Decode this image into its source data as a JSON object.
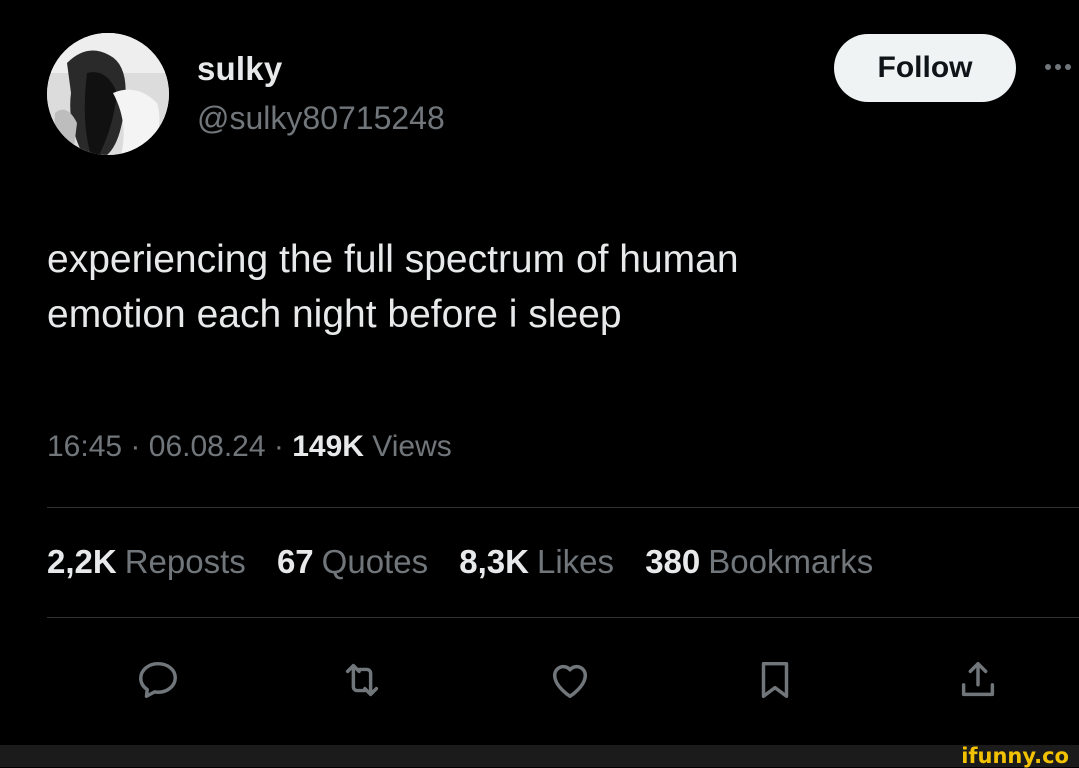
{
  "author": {
    "name": "sulky",
    "handle": "@sulky80715248"
  },
  "follow_button": {
    "label": "Follow"
  },
  "tweet": {
    "text_line_1": "experiencing the full spectrum of human",
    "text_line_2": "emotion each night before i sleep"
  },
  "meta": {
    "time": "16:45",
    "separator": "·",
    "date": "06.08.24",
    "views_count": "149K",
    "views_label": "Views"
  },
  "stats": [
    {
      "count": "2,2K",
      "label": "Reposts"
    },
    {
      "count": "67",
      "label": "Quotes"
    },
    {
      "count": "8,3K",
      "label": "Likes"
    },
    {
      "count": "380",
      "label": "Bookmarks"
    }
  ],
  "actions": {
    "reply_icon": "reply-icon",
    "repost_icon": "repost-icon",
    "like_icon": "heart-icon",
    "bookmark_icon": "bookmark-icon",
    "share_icon": "share-icon"
  },
  "watermark": "ifunny.co",
  "colors": {
    "background": "#000000",
    "primary_text": "#e7e9ea",
    "secondary_text": "#71767b",
    "follow_bg": "#eff3f4",
    "watermark": "#f2c200"
  }
}
